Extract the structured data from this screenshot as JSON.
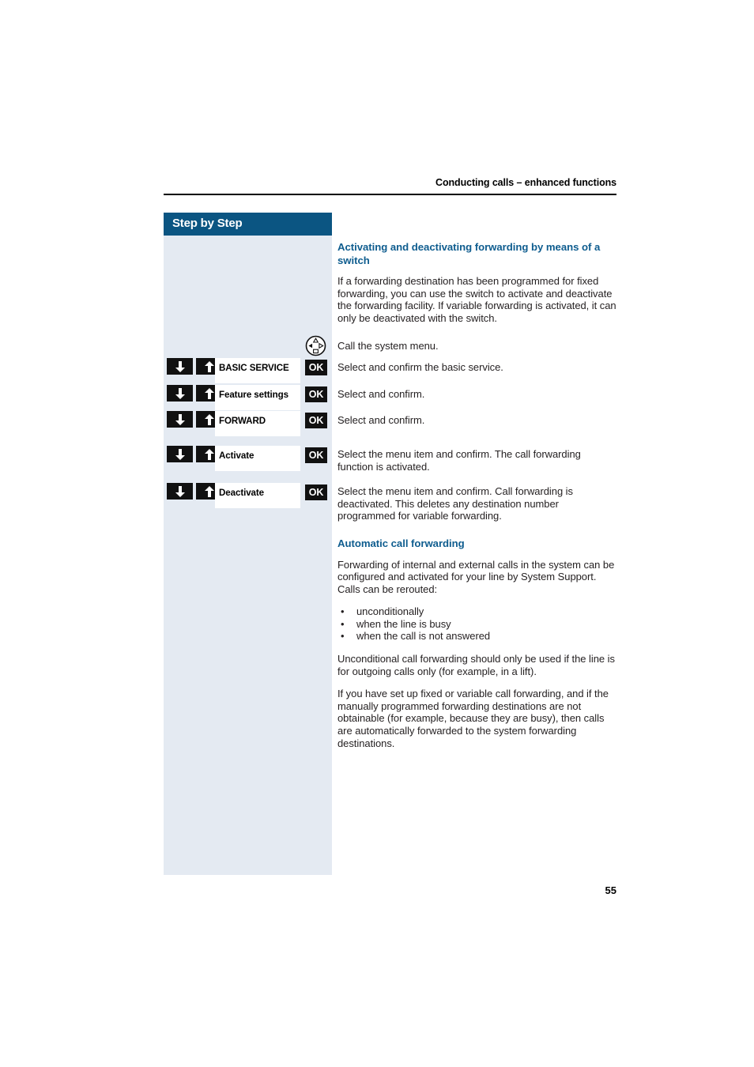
{
  "header": {
    "running_title": "Conducting calls – enhanced functions"
  },
  "sidebar": {
    "title": "Step by Step"
  },
  "page": {
    "number": "55"
  },
  "content": {
    "section1": {
      "heading": "Activating and deactivating forwarding by means of a switch",
      "intro": "If a forwarding destination has been programmed for fixed forwarding, you can use the switch to activate and deactivate the forwarding facility. If variable forwarding is activated, it can only be deactivated with the switch."
    },
    "section2": {
      "heading": "Automatic call forwarding",
      "intro": "Forwarding of internal and external calls in the system can be configured and activated for your line by System Support. Calls can be rerouted:",
      "bullets": [
        "unconditionally",
        "when the line is busy",
        "when the call is not answered"
      ],
      "bullet_marker": "•",
      "para2": "Unconditional call forwarding should only be used if the line is for outgoing calls only (for example, in a lift).",
      "para3": "If you have set up fixed or variable call forwarding, and if the manually programmed forwarding destinations are not obtainable (for example, because they are busy), then calls are automatically forwarded to the system forwarding destinations."
    }
  },
  "steps": {
    "nav_key_instruction": "Call the system menu.",
    "ok_label": "OK",
    "rows": [
      {
        "menu_label": "BASIC SERVICE",
        "instruction": "Select and confirm the basic service."
      },
      {
        "menu_label": "Feature settings",
        "instruction": "Select and confirm."
      },
      {
        "menu_label": "FORWARD",
        "instruction": "Select and confirm."
      },
      {
        "menu_label": "Activate",
        "instruction": "Select the menu item and confirm. The call forwarding function is activated."
      },
      {
        "menu_label": "Deactivate",
        "instruction": "Select the menu item and confirm. Call forwarding is deactivated. This deletes any destination number programmed for variable forwarding."
      }
    ]
  },
  "colors": {
    "brand_blue": "#0b5582",
    "heading_blue": "#0f5d8f",
    "panel_blue": "#e4eaf2",
    "key_black": "#111111"
  }
}
